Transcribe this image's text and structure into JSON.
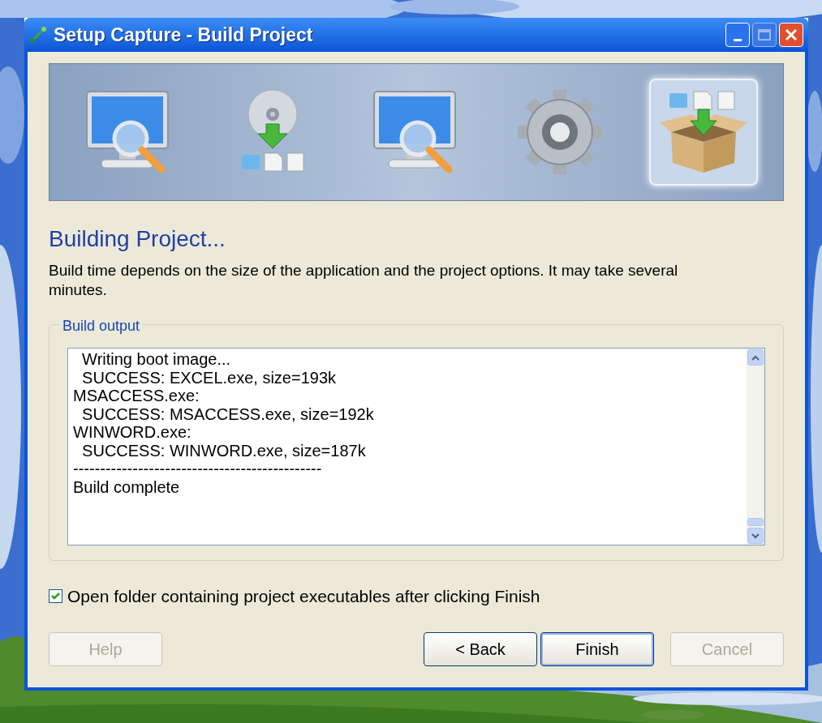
{
  "window": {
    "title": "Setup Capture - Build Project"
  },
  "steps": [
    {
      "kind": "scan",
      "selected": false
    },
    {
      "kind": "install",
      "selected": false
    },
    {
      "kind": "scan",
      "selected": false
    },
    {
      "kind": "configure",
      "selected": false
    },
    {
      "kind": "package",
      "selected": true
    }
  ],
  "heading": "Building Project...",
  "description": "Build time depends on the size of the application and the project options. It may take several minutes.",
  "output": {
    "label": "Build output",
    "lines": [
      "  Writing boot image...",
      "  SUCCESS: EXCEL.exe, size=193k",
      "MSACCESS.exe:",
      "  SUCCESS: MSACCESS.exe, size=192k",
      "WINWORD.exe:",
      "  SUCCESS: WINWORD.exe, size=187k",
      "----------------------------------------------",
      "Build complete"
    ]
  },
  "open_folder": {
    "label": "Open folder containing project executables after clicking Finish",
    "checked": true
  },
  "buttons": [
    {
      "label": "Help",
      "disabled": true,
      "default": false
    },
    {
      "label": "< Back",
      "disabled": false,
      "default": false
    },
    {
      "label": "Finish",
      "disabled": false,
      "default": true
    },
    {
      "label": "Cancel",
      "disabled": true,
      "default": false
    }
  ]
}
